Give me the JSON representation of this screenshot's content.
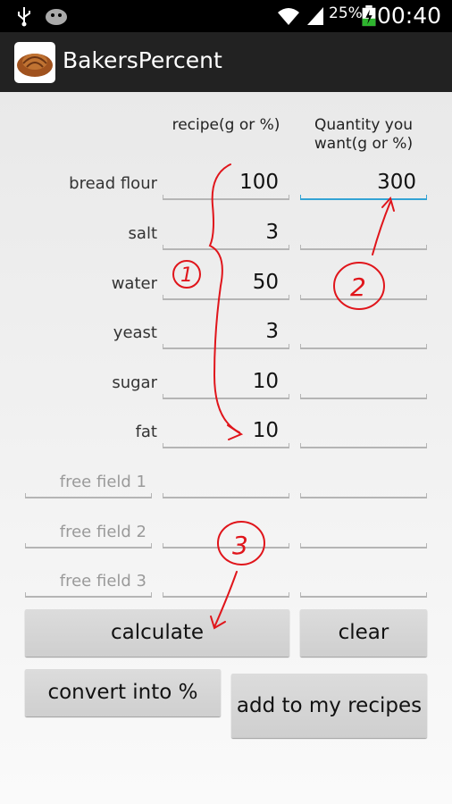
{
  "status_bar": {
    "battery_percent": "25%",
    "time": "00:40",
    "icons": [
      "usb-icon",
      "android-icon",
      "wifi-icon",
      "signal-icon",
      "battery-charging-icon"
    ]
  },
  "app_bar": {
    "title": "BakersPercent"
  },
  "headers": {
    "recipe": "recipe(g or %)",
    "quantity": "Quantity you want(g or %)"
  },
  "rows": [
    {
      "label": "bread flour",
      "recipe": "100",
      "quantity": "300"
    },
    {
      "label": "salt",
      "recipe": "3",
      "quantity": ""
    },
    {
      "label": "water",
      "recipe": "50",
      "quantity": ""
    },
    {
      "label": "yeast",
      "recipe": "3",
      "quantity": ""
    },
    {
      "label": "sugar",
      "recipe": "10",
      "quantity": ""
    },
    {
      "label": "fat",
      "recipe": "10",
      "quantity": ""
    }
  ],
  "free_fields": [
    {
      "placeholder": "free field 1"
    },
    {
      "placeholder": "free field 2"
    },
    {
      "placeholder": "free field 3"
    }
  ],
  "buttons": {
    "calculate": "calculate",
    "clear": "clear",
    "convert": "convert into %",
    "add": "add to my recipes"
  },
  "annotations": {
    "step1": "1",
    "step2": "2",
    "step3": "3",
    "color": "#e0151b"
  }
}
